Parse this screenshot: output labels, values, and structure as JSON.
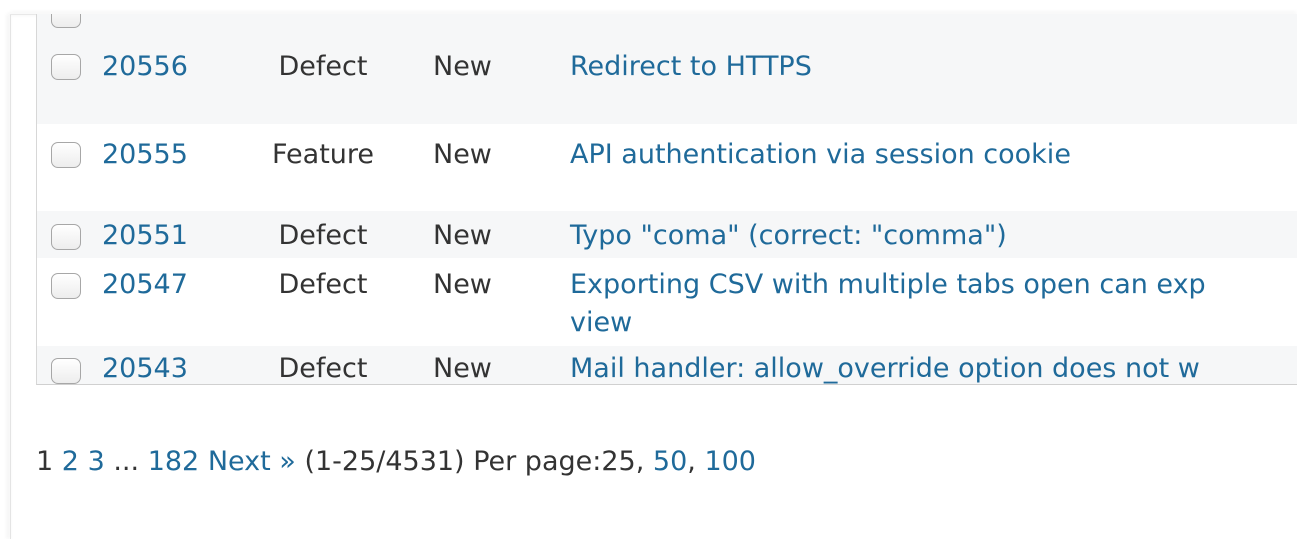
{
  "issues": [
    {
      "id": "20556",
      "tracker": "Defect",
      "status": "New",
      "subject": "Redirect to HTTPS",
      "subject_line2": ""
    },
    {
      "id": "20555",
      "tracker": "Feature",
      "status": "New",
      "subject": "API authentication via session cookie",
      "subject_line2": ""
    },
    {
      "id": "20551",
      "tracker": "Defect",
      "status": "New",
      "subject": "Typo \"coma\" (correct: \"comma\")",
      "subject_line2": ""
    },
    {
      "id": "20547",
      "tracker": "Defect",
      "status": "New",
      "subject": "Exporting CSV with multiple tabs open can exp",
      "subject_line2": "view"
    },
    {
      "id": "20543",
      "tracker": "Defect",
      "status": "New",
      "subject": "Mail handler: allow_override option does not w",
      "subject_line2": ""
    }
  ],
  "pagination": {
    "current_page": "1",
    "page_2": "2",
    "page_3": "3",
    "ellipsis": "...",
    "last_page": "182",
    "next": "Next »",
    "range": "(1-25/4531)",
    "per_page_label": "Per page:",
    "per_page_current": "25",
    "per_page_50": "50",
    "per_page_100": "100"
  }
}
